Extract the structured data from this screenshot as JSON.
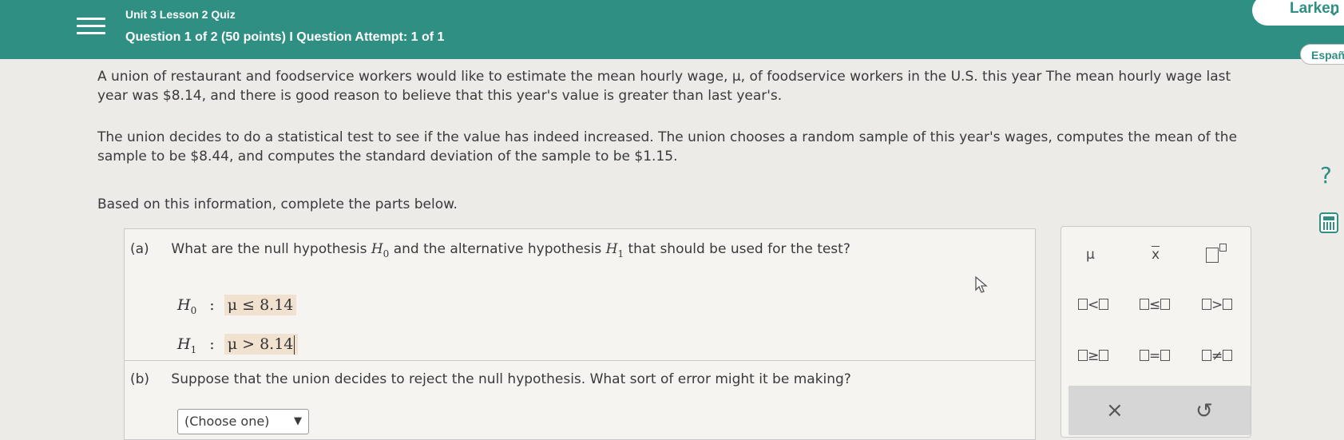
{
  "header": {
    "quiz_title": "Unit 3 Lesson 2 Quiz",
    "question_info": "Question 1 of 2 (50 points)  I  Question Attempt: 1 of 1",
    "user_name": "Larken",
    "background_color": "#2f8f83"
  },
  "sidebar": {
    "language_button": "Españ",
    "help_label": "?"
  },
  "problem": {
    "paragraph1": "A union of restaurant and foodservice workers would like to estimate the mean hourly wage, μ, of foodservice workers in the U.S. this year The mean hourly wage last year was $8.14, and there is good reason to believe that this year's value is greater than last year's.",
    "paragraph2": "The union decides to do a statistical test to see if the value has indeed increased. The union chooses a random sample of this year's wages, computes the mean of the sample to be $8.44, and computes the standard deviation of the sample to be $1.15.",
    "paragraph3": "Based on this information, complete the parts below."
  },
  "part_a": {
    "label": "(a)",
    "question_pre": "What are the null hypothesis",
    "h0_symbol": "H",
    "h0_sub": "0",
    "question_mid": "and the alternative hypothesis",
    "h1_symbol": "H",
    "h1_sub": "1",
    "question_post": "that should be used for the test?",
    "h0_var": "H",
    "h0_var_sub": "0",
    "h0_value": "μ ≤ 8.14",
    "h1_var": "H",
    "h1_var_sub": "1",
    "h1_value": "μ > 8.14"
  },
  "part_b": {
    "label": "(b)",
    "question": "Suppose that the union decides to reject the null hypothesis. What sort of error might it be making?",
    "select_value": "(Choose one)",
    "select_arrow": "▼"
  },
  "palette": {
    "mu": "μ",
    "xbar": "x",
    "less": "<",
    "leq": "≤",
    "greater": ">",
    "geq": "≥",
    "equal": "=",
    "neq": "≠",
    "clear": "×",
    "undo": "↺"
  }
}
